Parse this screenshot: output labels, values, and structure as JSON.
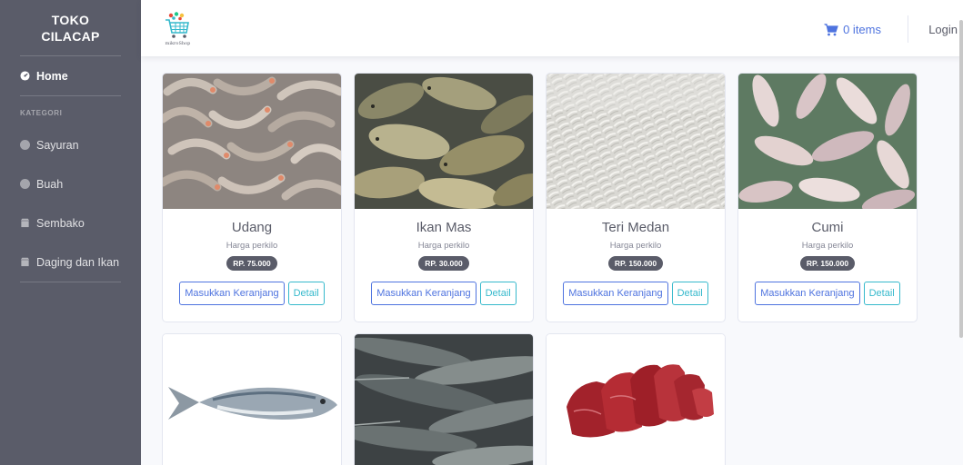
{
  "brand": {
    "line1": "TOKO",
    "line2": "CILACAP"
  },
  "sidebar": {
    "home": {
      "label": "Home",
      "icon": "tachometer-icon"
    },
    "heading": "KATEGORI",
    "items": [
      {
        "label": "Sayuran",
        "icon": "circle-icon"
      },
      {
        "label": "Buah",
        "icon": "circle-icon"
      },
      {
        "label": "Sembako",
        "icon": "shop-icon"
      },
      {
        "label": "Daging dan Ikan",
        "icon": "shop-icon"
      }
    ]
  },
  "topbar": {
    "logo_text": "mikroShop",
    "cart_label": "0 items",
    "login_label": "Login"
  },
  "products": [
    {
      "name": "Udang",
      "subtitle": "Harga perkilo",
      "price": "RP. 75.000",
      "cart_label": "Masukkan Keranjang",
      "detail_label": "Detail",
      "image": "shrimp"
    },
    {
      "name": "Ikan Mas",
      "subtitle": "Harga perkilo",
      "price": "RP. 30.000",
      "cart_label": "Masukkan Keranjang",
      "detail_label": "Detail",
      "image": "carp"
    },
    {
      "name": "Teri Medan",
      "subtitle": "Harga perkilo",
      "price": "RP. 150.000",
      "cart_label": "Masukkan Keranjang",
      "detail_label": "Detail",
      "image": "anchovy"
    },
    {
      "name": "Cumi",
      "subtitle": "Harga perkilo",
      "price": "RP. 150.000",
      "cart_label": "Masukkan Keranjang",
      "detail_label": "Detail",
      "image": "squid"
    },
    {
      "image": "mackerel"
    },
    {
      "image": "catfish"
    },
    {
      "image": "beef"
    }
  ],
  "colors": {
    "sidebar": "#5a5c69",
    "primary": "#4e73df",
    "info": "#36b9cc",
    "badge": "#5a5c69"
  }
}
